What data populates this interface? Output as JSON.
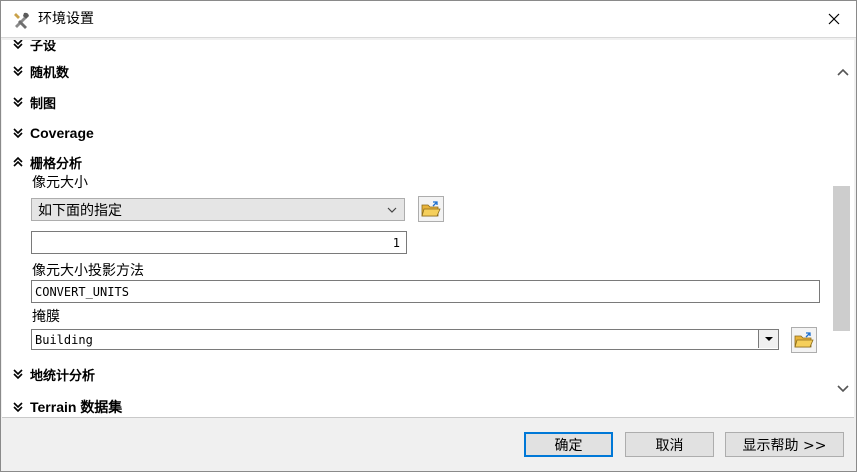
{
  "window": {
    "title": "环境设置"
  },
  "sections": {
    "cut_off": "子设",
    "random": "随机数",
    "cartography": "制图",
    "coverage": "Coverage",
    "raster": "栅格分析",
    "geostat": "地统计分析",
    "terrain": "Terrain 数据集"
  },
  "raster_analysis": {
    "cell_size_label": "像元大小",
    "cell_size_option": "如下面的指定",
    "cell_size_value": "1",
    "projection_label": "像元大小投影方法",
    "projection_value": "CONVERT_UNITS",
    "mask_label": "掩膜",
    "mask_value": "Building"
  },
  "buttons": {
    "ok": "确定",
    "cancel": "取消",
    "help": "显示帮助 >>"
  },
  "icons": {
    "title": "tools-icon",
    "close": "close-icon",
    "folder": "open-folder-icon",
    "chevron": "double-chevron-icon"
  },
  "colors": {
    "accent_border": "#0078d7",
    "scroll_thumb": "#cdcdcd",
    "folder_yellow": "#e8b33a"
  }
}
